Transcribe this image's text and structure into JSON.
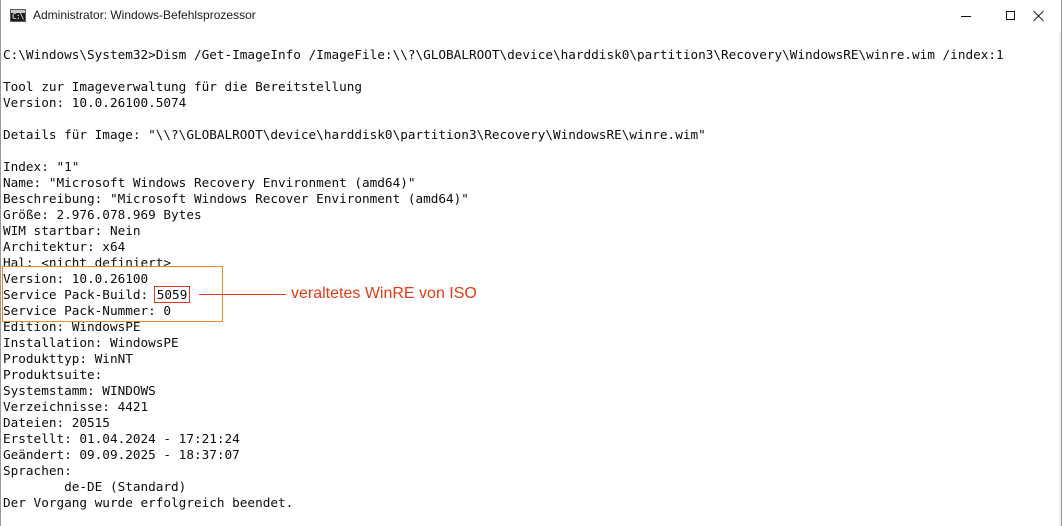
{
  "window": {
    "title": "Administrator: Windows-Befehlsprozessor",
    "icon": "cmd-icon",
    "icon_glyph": "C:\\"
  },
  "controls": {
    "minimize": "minimize-icon",
    "maximize": "maximize-icon",
    "close": "close-icon"
  },
  "console": {
    "lines": [
      "C:\\Windows\\System32>Dism /Get-ImageInfo /ImageFile:\\\\?\\GLOBALROOT\\device\\harddisk0\\partition3\\Recovery\\WindowsRE\\winre.wim /index:1",
      "",
      "Tool zur Imageverwaltung für die Bereitstellung",
      "Version: 10.0.26100.5074",
      "",
      "Details für Image: \"\\\\?\\GLOBALROOT\\device\\harddisk0\\partition3\\Recovery\\WindowsRE\\winre.wim\"",
      "",
      "Index: \"1\"",
      "Name: \"Microsoft Windows Recovery Environment (amd64)\"",
      "Beschreibung: \"Microsoft Windows Recover Environment (amd64)\"",
      "Größe: 2.976.078.969 Bytes",
      "WIM startbar: Nein",
      "Architektur: x64",
      "Hal: <nicht definiert>",
      "Version: 10.0.26100",
      "SERVICE_PACK_BUILD",
      "Service Pack-Nummer: 0",
      "Edition: WindowsPE",
      "Installation: WindowsPE",
      "Produkttyp: WinNT",
      "Produktsuite:",
      "Systemstamm: WINDOWS",
      "Verzeichnisse: 4421",
      "Dateien: 20515",
      "Erstellt: 01.04.2024 - 17:21:24",
      "Geändert: 09.09.2025 - 18:37:07",
      "Sprachen:",
      "        de-DE (Standard)",
      "Der Vorgang wurde erfolgreich beendet."
    ],
    "service_pack_build_label": "Service Pack-Build: ",
    "service_pack_build_value": "5059"
  },
  "annotation": {
    "text": "veraltetes WinRE von ISO",
    "color": "#e23b17",
    "box_color": "#e9892a"
  }
}
